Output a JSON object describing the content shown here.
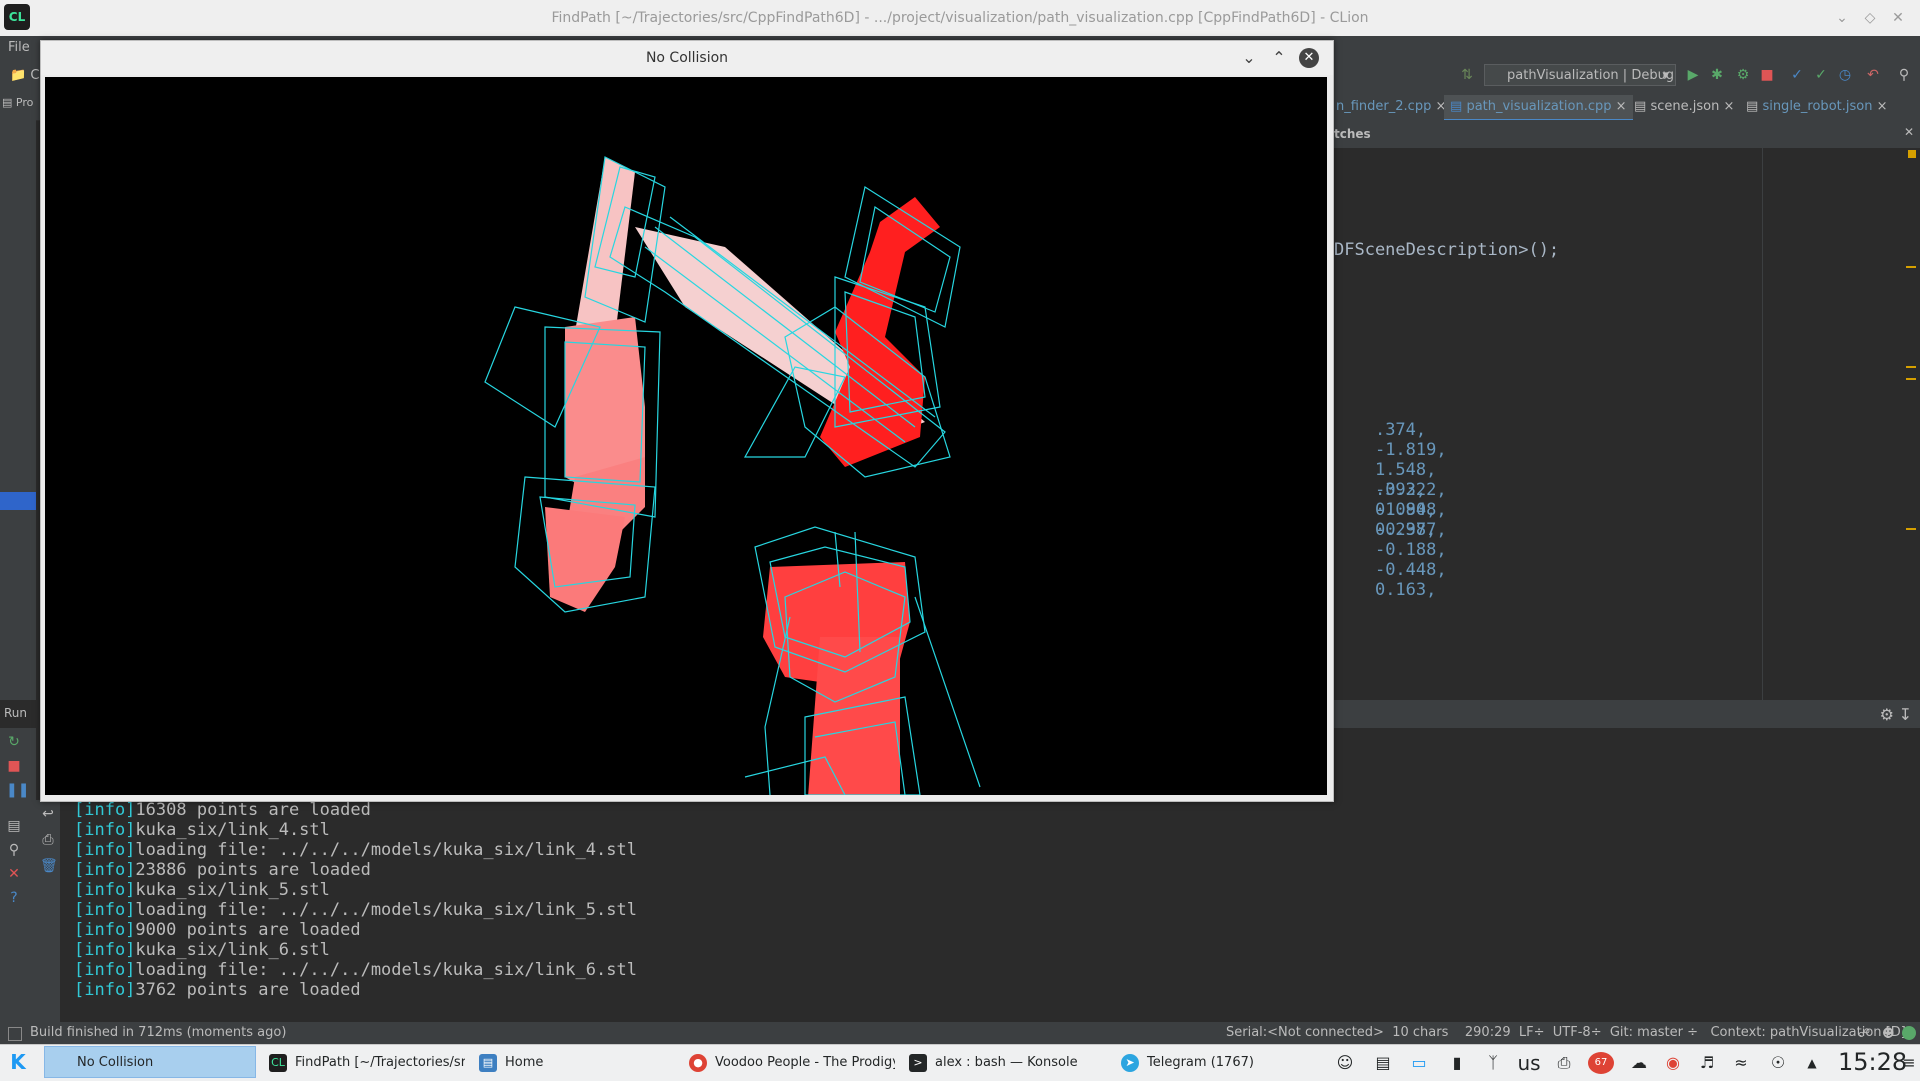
{
  "ide": {
    "title": "FindPath [~/Trajectories/src/CppFindPath6D] - .../project/visualization/path_visualization.cpp [CppFindPath6D] - CLion",
    "menu": {
      "file": "File"
    },
    "run_config": "pathVisualization | Debug",
    "tabs": [
      "n_finder_2.cpp",
      "path_visualization.cpp",
      "scene.json",
      "single_robot.json"
    ],
    "active_tab_index": 1,
    "editor_header": "tches",
    "code": {
      "line1": "DFSceneDescription>();",
      "line2_values": [
        ".374,",
        "-1.819,",
        "1.548,",
        "-0.222,",
        "0.090,",
        "-0.377,"
      ],
      "line3_values": [
        ".393,",
        "-1.848,",
        "0.298,",
        "-0.188,",
        "-0.448,",
        "0.163,"
      ]
    },
    "left_labels": {
      "project": "Pro",
      "c": "C",
      "run": "Run"
    },
    "console_tag": "[info]",
    "console_lines": [
      "16308 points are loaded",
      "kuka_six/link_4.stl",
      "loading file: ../../../models/kuka_six/link_4.stl",
      "23886 points are loaded",
      "kuka_six/link_5.stl",
      "loading file: ../../../models/kuka_six/link_5.stl",
      "9000 points are loaded",
      "kuka_six/link_6.stl",
      "loading file: ../../../models/kuka_six/link_6.stl",
      "3762 points are loaded"
    ],
    "status": {
      "left": "Build finished in 712ms (moments ago)",
      "serial": "Serial:<Not connected>",
      "chars": "10 chars",
      "position": "290:29",
      "line_sep": "LF÷",
      "encoding": "UTF-8÷",
      "git": "Git: master ÷",
      "context": "Context: pathVisualization [D]"
    }
  },
  "viewer": {
    "title": "No Collision"
  },
  "taskbar": {
    "tasks": [
      {
        "label": "No Collision",
        "active": true
      },
      {
        "label": "FindPath [~/Trajectories/src/",
        "active": false
      },
      {
        "label": "Home",
        "active": false
      },
      {
        "label": "Voodoo People - The Prodigy",
        "active": false
      },
      {
        "label": "alex : bash — Konsole",
        "active": false
      },
      {
        "label": "Telegram (1767)",
        "active": false
      }
    ],
    "keyboard_layout": "us",
    "notification_count": "67",
    "clock": "15:28"
  },
  "colors": {
    "robot_light": "#f7c3c3",
    "robot_mid": "#fa8080",
    "robot_red": "#ff1f1f",
    "bbox": "#27d6e0",
    "accent": "#4a88c7"
  }
}
